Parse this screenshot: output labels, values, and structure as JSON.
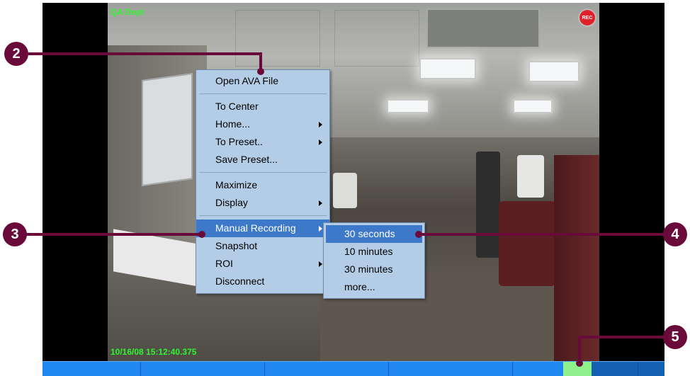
{
  "video": {
    "camera_name": "QA Dept",
    "timestamp": "10/16/08 15:12:40.375",
    "rec_badge": "REC"
  },
  "context_menu": {
    "items": [
      {
        "label": "Open AVA File",
        "has_submenu": false
      },
      {
        "label": "To Center",
        "has_submenu": false
      },
      {
        "label": "Home...",
        "has_submenu": true
      },
      {
        "label": "To Preset..",
        "has_submenu": true
      },
      {
        "label": "Save Preset...",
        "has_submenu": false
      },
      {
        "label": "Maximize",
        "has_submenu": false
      },
      {
        "label": "Display",
        "has_submenu": true
      },
      {
        "label": "Manual Recording",
        "has_submenu": true,
        "selected": true
      },
      {
        "label": "Snapshot",
        "has_submenu": false
      },
      {
        "label": "ROI",
        "has_submenu": true
      },
      {
        "label": "Disconnect",
        "has_submenu": false
      }
    ]
  },
  "recording_submenu": {
    "items": [
      {
        "label": "30 seconds",
        "selected": true
      },
      {
        "label": "10 minutes"
      },
      {
        "label": "30 minutes"
      },
      {
        "label": "more..."
      }
    ]
  },
  "callouts": {
    "two": "2",
    "three": "3",
    "four": "4",
    "five": "5"
  },
  "colors": {
    "callout": "#6a0a3a",
    "menu_bg": "#b4cde6",
    "menu_selected": "#3e79c9",
    "overlay_text": "#2ff52f",
    "timeline": "#1f87f0",
    "timeline_marker": "#8ef08a"
  }
}
